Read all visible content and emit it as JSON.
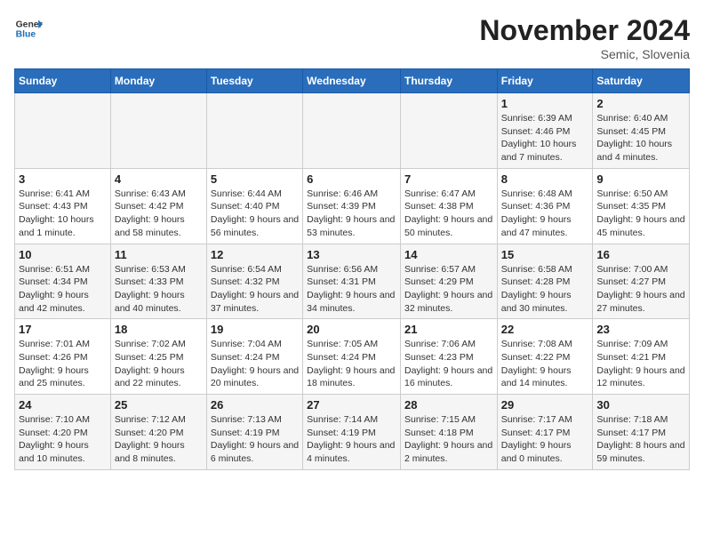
{
  "header": {
    "logo_general": "General",
    "logo_blue": "Blue",
    "month_title": "November 2024",
    "location": "Semic, Slovenia"
  },
  "columns": [
    "Sunday",
    "Monday",
    "Tuesday",
    "Wednesday",
    "Thursday",
    "Friday",
    "Saturday"
  ],
  "weeks": [
    [
      {
        "day": "",
        "info": ""
      },
      {
        "day": "",
        "info": ""
      },
      {
        "day": "",
        "info": ""
      },
      {
        "day": "",
        "info": ""
      },
      {
        "day": "",
        "info": ""
      },
      {
        "day": "1",
        "info": "Sunrise: 6:39 AM\nSunset: 4:46 PM\nDaylight: 10 hours and 7 minutes."
      },
      {
        "day": "2",
        "info": "Sunrise: 6:40 AM\nSunset: 4:45 PM\nDaylight: 10 hours and 4 minutes."
      }
    ],
    [
      {
        "day": "3",
        "info": "Sunrise: 6:41 AM\nSunset: 4:43 PM\nDaylight: 10 hours and 1 minute."
      },
      {
        "day": "4",
        "info": "Sunrise: 6:43 AM\nSunset: 4:42 PM\nDaylight: 9 hours and 58 minutes."
      },
      {
        "day": "5",
        "info": "Sunrise: 6:44 AM\nSunset: 4:40 PM\nDaylight: 9 hours and 56 minutes."
      },
      {
        "day": "6",
        "info": "Sunrise: 6:46 AM\nSunset: 4:39 PM\nDaylight: 9 hours and 53 minutes."
      },
      {
        "day": "7",
        "info": "Sunrise: 6:47 AM\nSunset: 4:38 PM\nDaylight: 9 hours and 50 minutes."
      },
      {
        "day": "8",
        "info": "Sunrise: 6:48 AM\nSunset: 4:36 PM\nDaylight: 9 hours and 47 minutes."
      },
      {
        "day": "9",
        "info": "Sunrise: 6:50 AM\nSunset: 4:35 PM\nDaylight: 9 hours and 45 minutes."
      }
    ],
    [
      {
        "day": "10",
        "info": "Sunrise: 6:51 AM\nSunset: 4:34 PM\nDaylight: 9 hours and 42 minutes."
      },
      {
        "day": "11",
        "info": "Sunrise: 6:53 AM\nSunset: 4:33 PM\nDaylight: 9 hours and 40 minutes."
      },
      {
        "day": "12",
        "info": "Sunrise: 6:54 AM\nSunset: 4:32 PM\nDaylight: 9 hours and 37 minutes."
      },
      {
        "day": "13",
        "info": "Sunrise: 6:56 AM\nSunset: 4:31 PM\nDaylight: 9 hours and 34 minutes."
      },
      {
        "day": "14",
        "info": "Sunrise: 6:57 AM\nSunset: 4:29 PM\nDaylight: 9 hours and 32 minutes."
      },
      {
        "day": "15",
        "info": "Sunrise: 6:58 AM\nSunset: 4:28 PM\nDaylight: 9 hours and 30 minutes."
      },
      {
        "day": "16",
        "info": "Sunrise: 7:00 AM\nSunset: 4:27 PM\nDaylight: 9 hours and 27 minutes."
      }
    ],
    [
      {
        "day": "17",
        "info": "Sunrise: 7:01 AM\nSunset: 4:26 PM\nDaylight: 9 hours and 25 minutes."
      },
      {
        "day": "18",
        "info": "Sunrise: 7:02 AM\nSunset: 4:25 PM\nDaylight: 9 hours and 22 minutes."
      },
      {
        "day": "19",
        "info": "Sunrise: 7:04 AM\nSunset: 4:24 PM\nDaylight: 9 hours and 20 minutes."
      },
      {
        "day": "20",
        "info": "Sunrise: 7:05 AM\nSunset: 4:24 PM\nDaylight: 9 hours and 18 minutes."
      },
      {
        "day": "21",
        "info": "Sunrise: 7:06 AM\nSunset: 4:23 PM\nDaylight: 9 hours and 16 minutes."
      },
      {
        "day": "22",
        "info": "Sunrise: 7:08 AM\nSunset: 4:22 PM\nDaylight: 9 hours and 14 minutes."
      },
      {
        "day": "23",
        "info": "Sunrise: 7:09 AM\nSunset: 4:21 PM\nDaylight: 9 hours and 12 minutes."
      }
    ],
    [
      {
        "day": "24",
        "info": "Sunrise: 7:10 AM\nSunset: 4:20 PM\nDaylight: 9 hours and 10 minutes."
      },
      {
        "day": "25",
        "info": "Sunrise: 7:12 AM\nSunset: 4:20 PM\nDaylight: 9 hours and 8 minutes."
      },
      {
        "day": "26",
        "info": "Sunrise: 7:13 AM\nSunset: 4:19 PM\nDaylight: 9 hours and 6 minutes."
      },
      {
        "day": "27",
        "info": "Sunrise: 7:14 AM\nSunset: 4:19 PM\nDaylight: 9 hours and 4 minutes."
      },
      {
        "day": "28",
        "info": "Sunrise: 7:15 AM\nSunset: 4:18 PM\nDaylight: 9 hours and 2 minutes."
      },
      {
        "day": "29",
        "info": "Sunrise: 7:17 AM\nSunset: 4:17 PM\nDaylight: 9 hours and 0 minutes."
      },
      {
        "day": "30",
        "info": "Sunrise: 7:18 AM\nSunset: 4:17 PM\nDaylight: 8 hours and 59 minutes."
      }
    ]
  ]
}
